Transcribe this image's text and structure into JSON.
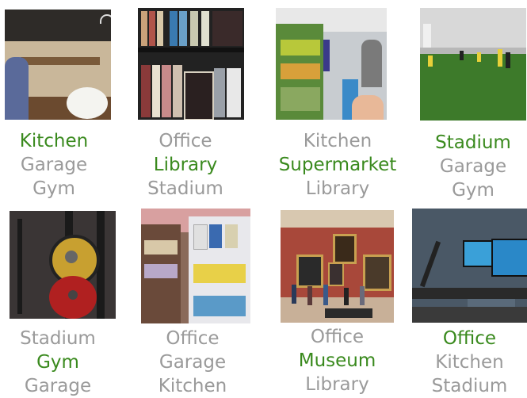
{
  "items": [
    {
      "scene": "kitchen",
      "labels": [
        "Kitchen",
        "Garage",
        "Gym"
      ],
      "correct_index": 0
    },
    {
      "scene": "library",
      "labels": [
        "Office",
        "Library",
        "Stadium"
      ],
      "correct_index": 1
    },
    {
      "scene": "supermarket",
      "labels": [
        "Kitchen",
        "Supermarket",
        "Library"
      ],
      "correct_index": 1
    },
    {
      "scene": "stadium",
      "labels": [
        "Stadium",
        "Garage",
        "Gym"
      ],
      "correct_index": 0
    },
    {
      "scene": "gym",
      "labels": [
        "Stadium",
        "Gym",
        "Garage"
      ],
      "correct_index": 1
    },
    {
      "scene": "supermarket-aisle",
      "labels": [
        "Office",
        "Garage",
        "Kitchen"
      ],
      "correct_index": null
    },
    {
      "scene": "museum",
      "labels": [
        "Office",
        "Museum",
        "Library"
      ],
      "correct_index": 1
    },
    {
      "scene": "office",
      "labels": [
        "Office",
        "Kitchen",
        "Stadium"
      ],
      "correct_index": 0
    }
  ],
  "colors": {
    "correct": "#3a8a1e",
    "incorrect": "#9a9a9a"
  }
}
